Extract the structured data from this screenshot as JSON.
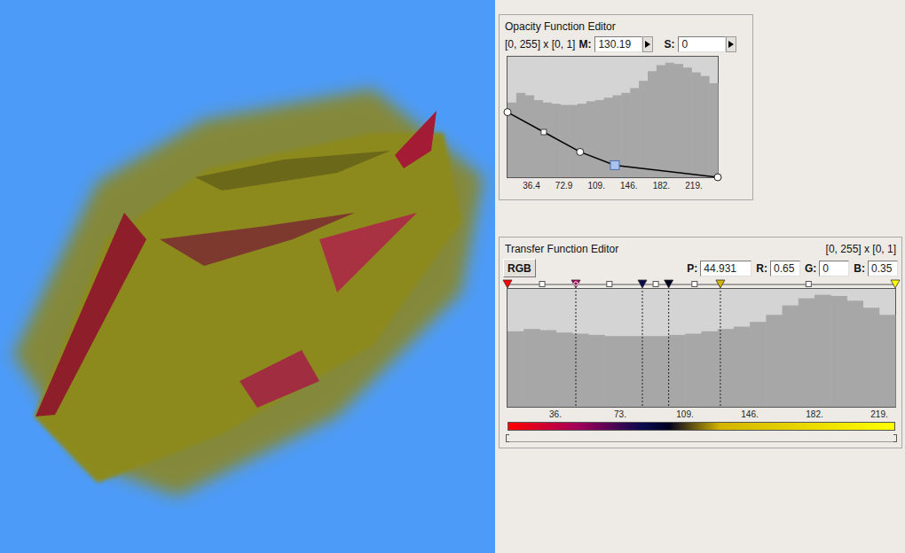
{
  "opacity_editor": {
    "title": "Opacity Function Editor",
    "range": "[0, 255] x [0, 1]",
    "m_label": "M:",
    "m_value": "130.19",
    "s_label": "S:",
    "s_value": "0",
    "ticks": [
      "36.4",
      "72.9",
      "109.",
      "146.",
      "182.",
      "219."
    ],
    "histogram": [
      0.62,
      0.7,
      0.68,
      0.64,
      0.62,
      0.61,
      0.6,
      0.6,
      0.61,
      0.63,
      0.64,
      0.66,
      0.68,
      0.7,
      0.74,
      0.8,
      0.88,
      0.93,
      0.95,
      0.94,
      0.91,
      0.87,
      0.84,
      0.78
    ],
    "points": [
      {
        "value": 0,
        "opacity": 0.54,
        "kind": "circle",
        "selected": false
      },
      {
        "value": 44,
        "opacity": 0.375,
        "kind": "square",
        "selected": false
      },
      {
        "value": 88,
        "opacity": 0.21,
        "kind": "circle",
        "selected": false
      },
      {
        "value": 130.19,
        "opacity": 0.1,
        "kind": "square",
        "selected": true
      },
      {
        "value": 255,
        "opacity": 0,
        "kind": "circle",
        "selected": false
      }
    ]
  },
  "transfer_editor": {
    "title": "Transfer Function Editor",
    "range": "[0, 255] x [0, 1]",
    "mode_button": "RGB",
    "fields": [
      {
        "label": "P:",
        "value": "44.931"
      },
      {
        "label": "R:",
        "value": "0.65"
      },
      {
        "label": "G:",
        "value": "0"
      },
      {
        "label": "B:",
        "value": "0.35"
      }
    ],
    "ticks": [
      "36.",
      "73.",
      "109.",
      "146.",
      "182.",
      "219."
    ],
    "histogram": [
      0.64,
      0.66,
      0.65,
      0.63,
      0.62,
      0.61,
      0.6,
      0.6,
      0.6,
      0.6,
      0.61,
      0.62,
      0.64,
      0.66,
      0.68,
      0.72,
      0.78,
      0.86,
      0.92,
      0.95,
      0.94,
      0.9,
      0.84,
      0.78
    ],
    "markers": [
      {
        "value": 0,
        "kind": "triangle",
        "color": "#ff0000",
        "selected": false,
        "dashed": false
      },
      {
        "value": 22.8,
        "kind": "square",
        "color": "#ffffff",
        "selected": false,
        "dashed": false
      },
      {
        "value": 44.931,
        "kind": "triangle",
        "color": "#a60059",
        "selected": true,
        "dashed": true
      },
      {
        "value": 67,
        "kind": "square",
        "color": "#ffffff",
        "selected": false,
        "dashed": false
      },
      {
        "value": 88.7,
        "kind": "triangle",
        "color": "#0a0a50",
        "selected": false,
        "dashed": true
      },
      {
        "value": 97.5,
        "kind": "square",
        "color": "#ffffff",
        "selected": false,
        "dashed": false
      },
      {
        "value": 106,
        "kind": "triangle",
        "color": "#000020",
        "selected": false,
        "dashed": true
      },
      {
        "value": 123,
        "kind": "square",
        "color": "#ffffff",
        "selected": false,
        "dashed": false
      },
      {
        "value": 140,
        "kind": "triangle",
        "color": "#d4b400",
        "selected": false,
        "dashed": true
      },
      {
        "value": 198,
        "kind": "square",
        "color": "#ffffff",
        "selected": false,
        "dashed": false
      },
      {
        "value": 255,
        "kind": "triangle",
        "color": "#ffff00",
        "selected": false,
        "dashed": false
      }
    ]
  }
}
